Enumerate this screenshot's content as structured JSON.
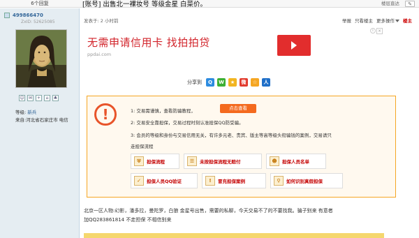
{
  "topbar": {
    "reply_count": "6个回复",
    "title": "[账号] 出售北一裸妆号    等级金星    白菜价。",
    "nav": "楼层直达",
    "btn_icon": "pencil-icon"
  },
  "user": {
    "name": "499866470",
    "zxid": "ZxID: 52625085",
    "level_label": "等级:",
    "level_value": "新兵",
    "origin": "来自:河北省石家庄市 电信"
  },
  "post": {
    "meta": "发表于: 2 小时前",
    "actions": [
      "举报",
      "只看楼主",
      "更多操作"
    ],
    "accent_action": "楼主"
  },
  "ad": {
    "title": "无需申请信用卡 找拍拍贷",
    "url": "ppdai.com",
    "close": "×",
    "info": "i"
  },
  "share": {
    "label": "分享到",
    "icons": [
      "qq-icon",
      "wechat-icon",
      "qzone-icon",
      "weibo-icon",
      "star-icon",
      "renren-icon"
    ]
  },
  "notice": {
    "line1": "1: 交易需谨慎，查看防骗教程，",
    "check_btn": "点击查看",
    "line2": "2: 交易安全靠担保，交易过程时刻认准担保QQ防受骗。",
    "line3": "3: 会员的等级和身份与交易信用无关，有许多元老、贵宾、版主等高等级头衔骗钱的案例，交易请只",
    "line3b": "走担保流程",
    "buttons": [
      "担保流程",
      "未按担保流程无赔付",
      "担保人员名单",
      "担保人员QQ验证",
      "冒充担保案例",
      "如何识别真假担保"
    ]
  },
  "body_text": {
    "line1": "北京一区人物:幻影，潘多拉，曼陀罗，白狼    金星号出售，需要的私聊，今天交易不了的不要找我。骗子别来    有意者",
    "line2": "加QQ283861814        不走担保    不相信别来"
  },
  "colors": {
    "accent_red": "#d2232a",
    "notice_border": "#f5a623",
    "orange_button": "#f46a1e",
    "sidebar_bg": "#e5edf2"
  }
}
